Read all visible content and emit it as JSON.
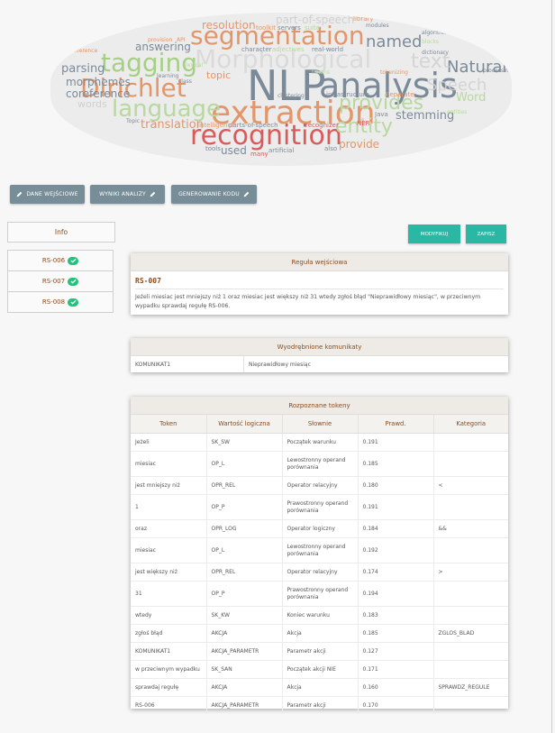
{
  "word_cloud": {
    "words": [
      {
        "text": "NLP",
        "color": "#7b8a99"
      },
      {
        "text": "analysis",
        "color": "#7b8a99"
      },
      {
        "text": "extraction",
        "color": "#e2966a"
      },
      {
        "text": "recognition",
        "color": "#d95a5a"
      },
      {
        "text": "segmentation",
        "color": "#e2966a"
      },
      {
        "text": "tagging",
        "color": "#a6cf85"
      },
      {
        "text": "Dirichlet",
        "color": "#e2966a"
      },
      {
        "text": "language",
        "color": "#b8d8a0"
      },
      {
        "text": "Morphological",
        "color": "#d8d8d8"
      },
      {
        "text": "entity",
        "color": "#b8d8a0"
      },
      {
        "text": "provides",
        "color": "#b8d8a0"
      },
      {
        "text": "Natural",
        "color": "#7b8a99"
      },
      {
        "text": "named",
        "color": "#7b8a99"
      },
      {
        "text": "Speech",
        "color": "#d0d0d0"
      },
      {
        "text": "stemming",
        "color": "#7b8a99"
      },
      {
        "text": "Word",
        "color": "#b8d8a0"
      },
      {
        "text": "translation",
        "color": "#e2966a"
      },
      {
        "text": "provide",
        "color": "#e2966a"
      },
      {
        "text": "used",
        "color": "#7b8a99"
      },
      {
        "text": "morphemes",
        "color": "#7b8a99"
      },
      {
        "text": "coreference",
        "color": "#7b8a99"
      },
      {
        "text": "parsing",
        "color": "#7b8a99"
      },
      {
        "text": "answering",
        "color": "#7b8a99"
      },
      {
        "text": "resolution",
        "color": "#e2966a"
      },
      {
        "text": "part-of-speech",
        "color": "#d0d0d0"
      },
      {
        "text": "topic",
        "color": "#e2966a"
      },
      {
        "text": "words",
        "color": "#d0d0d0"
      },
      {
        "text": "text",
        "color": "#d0d0d0"
      },
      {
        "text": "parts-of-speech",
        "color": "#7b8a99"
      },
      {
        "text": "intelligence",
        "color": "#e2966a"
      },
      {
        "text": "infrastructure",
        "color": "#7b8a99"
      },
      {
        "text": "recognizer",
        "color": "#d95a5a"
      },
      {
        "text": "Java",
        "color": "#7b8a99"
      },
      {
        "text": "tools",
        "color": "#7b8a99"
      },
      {
        "text": "many",
        "color": "#d95a5a"
      },
      {
        "text": "artificial",
        "color": "#7b8a99"
      },
      {
        "text": "also",
        "color": "#7b8a99"
      },
      {
        "text": "real-world",
        "color": "#7b8a99"
      },
      {
        "text": "character",
        "color": "#7b8a99"
      },
      {
        "text": "adjectives",
        "color": "#b8d8a0"
      },
      {
        "text": "toolkit",
        "color": "#e2966a"
      },
      {
        "text": "servers",
        "color": "#7b8a99"
      },
      {
        "text": "suite",
        "color": "#b8d8a0"
      },
      {
        "text": "library",
        "color": "#e2966a"
      },
      {
        "text": "tokenizing",
        "color": "#e2966a"
      },
      {
        "text": "Separate",
        "color": "#e2966a"
      },
      {
        "text": "dictionary",
        "color": "#7b8a99"
      },
      {
        "text": "learning",
        "color": "#7b8a99"
      },
      {
        "text": "class",
        "color": "#7b8a99"
      },
      {
        "text": "Topic",
        "color": "#7b8a99"
      },
      {
        "text": "provision",
        "color": "#e2966a"
      },
      {
        "text": "API",
        "color": "#e2966a"
      },
      {
        "text": "Conference",
        "color": "#e2966a"
      },
      {
        "text": "processing",
        "color": "#7b8a99"
      },
      {
        "text": "algorithms",
        "color": "#7b8a99"
      },
      {
        "text": "blocks",
        "color": "#b8d8a0"
      },
      {
        "text": "modules",
        "color": "#7b8a99"
      },
      {
        "text": "entities",
        "color": "#b8d8a0"
      },
      {
        "text": "clustering",
        "color": "#7b8a99"
      },
      {
        "text": "tokens",
        "color": "#b8d8a0"
      },
      {
        "text": "NER",
        "color": "#d95a5a"
      },
      {
        "text": "lexical",
        "color": "#b8d8a0"
      }
    ]
  },
  "nav": {
    "input_label": "DANE WEJŚCIOWE",
    "results_label": "WYNIKI ANALIZY",
    "codegen_label": "GENEROWANIE KODU"
  },
  "sidebar": {
    "info_label": "Info",
    "rules": [
      {
        "label": "RS-006"
      },
      {
        "label": "RS-007"
      },
      {
        "label": "RS-008"
      }
    ]
  },
  "actions": {
    "modify_label": "MODYFIKUJ",
    "save_label": "ZAPISZ"
  },
  "input_rule": {
    "header": "Reguła wejściowa",
    "code": "RS-007",
    "text": "Jeżeli miesiac jest mniejszy niż 1 oraz miesiac jest większy niż 31 wtedy zgłoś błąd \"Nieprawidłowy miesiąc\", w przeciwnym wypadku sprawdaj regułę RS-006."
  },
  "messages": {
    "header": "Wyodrębnione komunikaty",
    "rows": [
      {
        "key": "KOMUNIKAT1",
        "value": "Nieprawidłowy miesiąc"
      }
    ]
  },
  "tokens": {
    "header": "Rozpoznane tokeny",
    "columns": [
      "Token",
      "Wartość logiczna",
      "Słownie",
      "Prawd.",
      "Kategoria"
    ],
    "rows": [
      {
        "token": "Jeżeli",
        "logic": "SK_SW",
        "words": "Początek warunku",
        "prob": "0.191",
        "category": ""
      },
      {
        "token": "miesiac",
        "logic": "OP_L",
        "words": "Lewostronny operand porównania",
        "prob": "0.185",
        "category": ""
      },
      {
        "token": "jest mniejszy niż",
        "logic": "OPR_REL",
        "words": "Operator relacyjny",
        "prob": "0.180",
        "category": "<"
      },
      {
        "token": "1",
        "logic": "OP_P",
        "words": "Prawostronny operand porównania",
        "prob": "0.191",
        "category": ""
      },
      {
        "token": "oraz",
        "logic": "OPR_LOG",
        "words": "Operator logiczny",
        "prob": "0.184",
        "category": "&&"
      },
      {
        "token": "miesiac",
        "logic": "OP_L",
        "words": "Lewostronny operand porównania",
        "prob": "0.192",
        "category": ""
      },
      {
        "token": "jest większy niż",
        "logic": "OPR_REL",
        "words": "Operator relacyjny",
        "prob": "0.174",
        "category": ">"
      },
      {
        "token": "31",
        "logic": "OP_P",
        "words": "Prawostronny operand porównania",
        "prob": "0.194",
        "category": ""
      },
      {
        "token": "wtedy",
        "logic": "SK_KW",
        "words": "Koniec warunku",
        "prob": "0.183",
        "category": ""
      },
      {
        "token": "zgłoś błąd",
        "logic": "AKCJA",
        "words": "Akcja",
        "prob": "0.185",
        "category": "ZGLOS_BLAD"
      },
      {
        "token": "KOMUNIKAT1",
        "logic": "AKCJA_PARAMETR",
        "words": "Parametr akcji",
        "prob": "0.127",
        "category": ""
      },
      {
        "token": "w przeciwnym wypadku",
        "logic": "SK_SAN",
        "words": "Początek akcji NIE",
        "prob": "0.171",
        "category": ""
      },
      {
        "token": "sprawdaj regułę",
        "logic": "AKCJA",
        "words": "Akcja",
        "prob": "0.160",
        "category": "SPRAWDZ_REGULE"
      },
      {
        "token": "RS-006",
        "logic": "AKCJA_PARAMETR",
        "words": "Parametr akcji",
        "prob": "0.170",
        "category": ""
      }
    ]
  }
}
